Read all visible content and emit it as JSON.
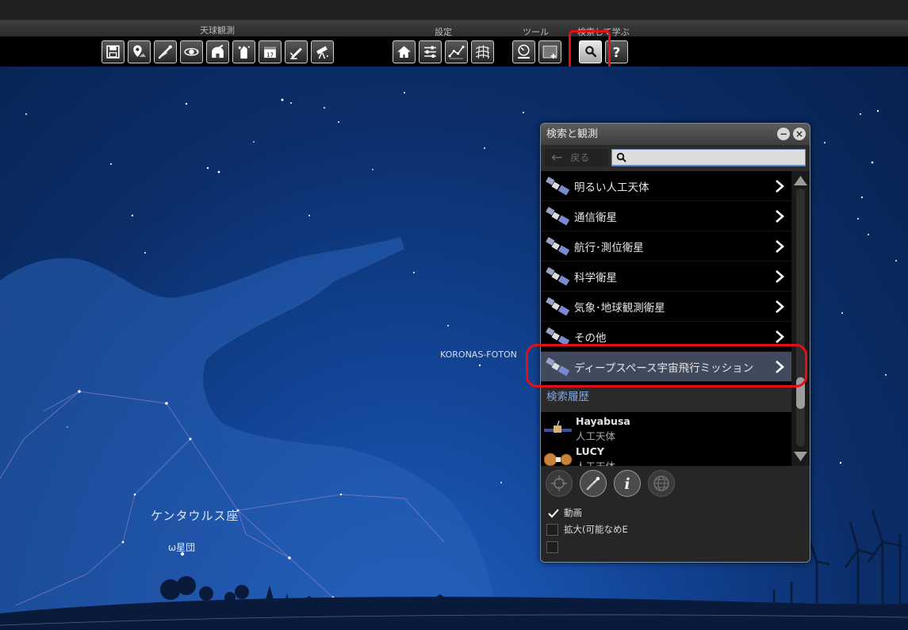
{
  "toolbar": {
    "groups": {
      "observation": "天球観測",
      "settings": "設定",
      "tools": "ツール",
      "search_learn": "検索して学ぶ"
    }
  },
  "sky": {
    "satellite_label": "KORONAS-FOTON",
    "constellation_label": "ケンタウルス座",
    "cluster_label": "ω星団"
  },
  "panel": {
    "title": "検索と観測",
    "back_label": "戻る",
    "search_value": "",
    "categories": [
      {
        "label": "明るい人工天体"
      },
      {
        "label": "通信衛星"
      },
      {
        "label": "航行･測位衛星"
      },
      {
        "label": "科学衛星"
      },
      {
        "label": "気象･地球観測衛星"
      },
      {
        "label": "その他"
      },
      {
        "label": "ディープスペース宇宙飛行ミッション"
      }
    ],
    "history_header": "検索履歴",
    "history": [
      {
        "name": "Hayabusa",
        "type": "人工天体"
      },
      {
        "name": "LUCY",
        "type": "人工天体"
      }
    ],
    "options": [
      {
        "label": "動画",
        "checked": true
      },
      {
        "label": "拡大(可能なめE",
        "checked": false
      },
      {
        "label": "",
        "checked": false
      }
    ]
  },
  "colors": {
    "highlight": "#e3101a",
    "link_blue": "#7fa6e6",
    "selected_row": "#414a5c"
  }
}
